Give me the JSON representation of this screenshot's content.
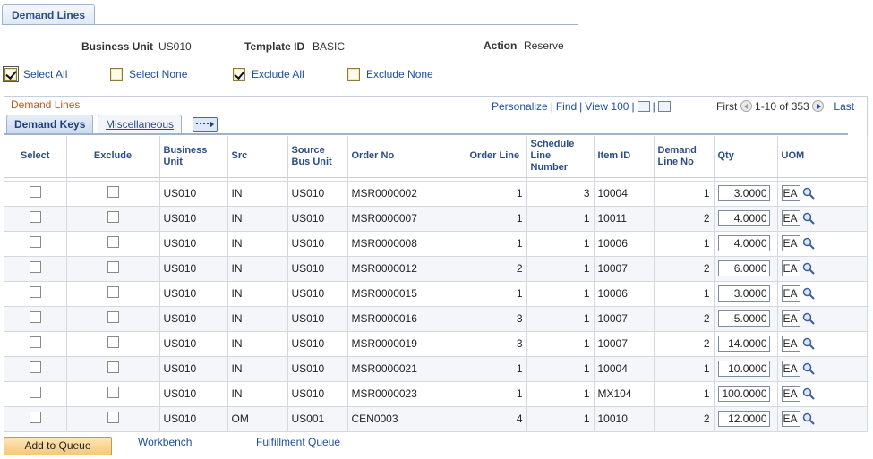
{
  "page_tab": "Demand Lines",
  "header": {
    "business_unit_label": "Business Unit",
    "business_unit_value": "US010",
    "template_id_label": "Template ID",
    "template_id_value": "BASIC",
    "action_label": "Action",
    "action_value": "Reserve"
  },
  "options": {
    "select_all": "Select All",
    "select_none": "Select None",
    "exclude_all": "Exclude All",
    "exclude_none": "Exclude None"
  },
  "grid": {
    "title": "Demand Lines",
    "nav": {
      "personalize": "Personalize",
      "find": "Find",
      "view": "View 100",
      "first": "First",
      "range": "1-10 of 353",
      "last": "Last"
    },
    "tabs": [
      "Demand Keys",
      "Miscellaneous"
    ],
    "columns": [
      "Select",
      "Exclude",
      "Business Unit",
      "Src",
      "Source Bus Unit",
      "Order No",
      "Order Line",
      "Schedule Line Number",
      "Item ID",
      "Demand Line No",
      "Qty",
      "UOM"
    ],
    "rows": [
      {
        "bu": "US010",
        "src": "IN",
        "sbu": "US010",
        "order": "MSR0000002",
        "line": "1",
        "sched": "3",
        "item": "10004",
        "dline": "1",
        "qty": "3.0000",
        "uom": "EA"
      },
      {
        "bu": "US010",
        "src": "IN",
        "sbu": "US010",
        "order": "MSR0000007",
        "line": "1",
        "sched": "1",
        "item": "10011",
        "dline": "2",
        "qty": "4.0000",
        "uom": "EA"
      },
      {
        "bu": "US010",
        "src": "IN",
        "sbu": "US010",
        "order": "MSR0000008",
        "line": "1",
        "sched": "1",
        "item": "10006",
        "dline": "1",
        "qty": "4.0000",
        "uom": "EA"
      },
      {
        "bu": "US010",
        "src": "IN",
        "sbu": "US010",
        "order": "MSR0000012",
        "line": "2",
        "sched": "1",
        "item": "10007",
        "dline": "2",
        "qty": "6.0000",
        "uom": "EA"
      },
      {
        "bu": "US010",
        "src": "IN",
        "sbu": "US010",
        "order": "MSR0000015",
        "line": "1",
        "sched": "1",
        "item": "10006",
        "dline": "1",
        "qty": "3.0000",
        "uom": "EA"
      },
      {
        "bu": "US010",
        "src": "IN",
        "sbu": "US010",
        "order": "MSR0000016",
        "line": "3",
        "sched": "1",
        "item": "10007",
        "dline": "2",
        "qty": "5.0000",
        "uom": "EA"
      },
      {
        "bu": "US010",
        "src": "IN",
        "sbu": "US010",
        "order": "MSR0000019",
        "line": "3",
        "sched": "1",
        "item": "10007",
        "dline": "2",
        "qty": "14.0000",
        "uom": "EA"
      },
      {
        "bu": "US010",
        "src": "IN",
        "sbu": "US010",
        "order": "MSR0000021",
        "line": "1",
        "sched": "1",
        "item": "10004",
        "dline": "1",
        "qty": "10.0000",
        "uom": "EA"
      },
      {
        "bu": "US010",
        "src": "IN",
        "sbu": "US010",
        "order": "MSR0000023",
        "line": "1",
        "sched": "1",
        "item": "MX104",
        "dline": "1",
        "qty": "100.0000",
        "uom": "EA"
      },
      {
        "bu": "US010",
        "src": "OM",
        "sbu": "US001",
        "order": "CEN0003",
        "line": "4",
        "sched": "1",
        "item": "10010",
        "dline": "2",
        "qty": "12.0000",
        "uom": "EA"
      }
    ]
  },
  "footer": {
    "add_to_queue": "Add to Queue",
    "workbench": "Workbench",
    "fulfillment_queue": "Fulfillment Queue"
  },
  "colors": {
    "link": "#1f4ea3",
    "grid_title": "#c05b16",
    "header_text": "#2b4d87",
    "button_bg": "#f7c878"
  }
}
